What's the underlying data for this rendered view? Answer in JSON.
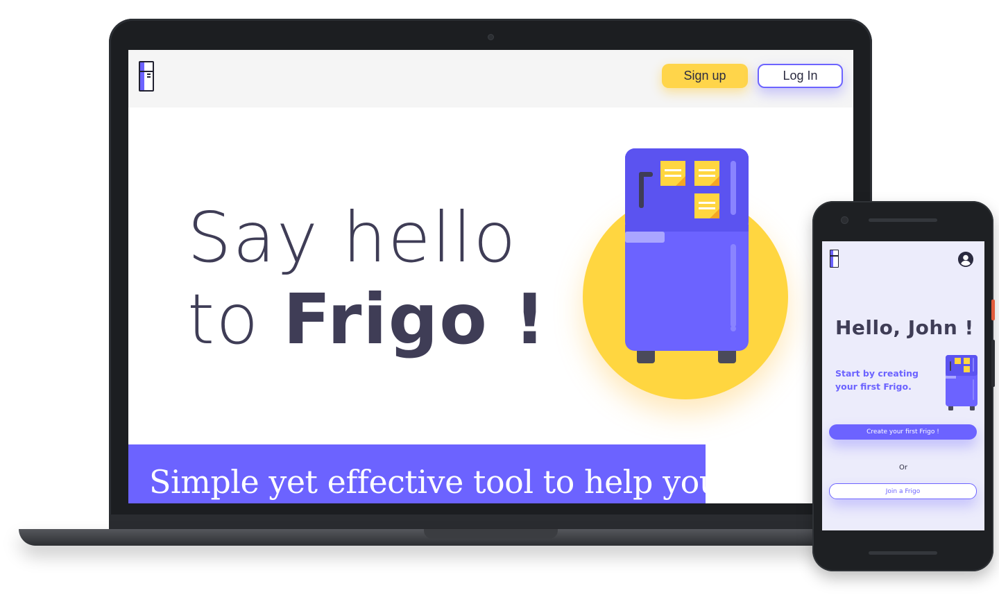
{
  "laptop": {
    "header": {
      "logo_icon": "fridge-logo-icon",
      "signup_label": "Sign up",
      "login_label": "Log In"
    },
    "hero": {
      "title_line1": "Say hello",
      "title_line2_prefix": "to ",
      "title_line2_strong": "Frigo !",
      "illustration_icon": "fridge-with-sticky-notes-icon"
    },
    "tagline": "Simple yet effective tool to help you"
  },
  "phone": {
    "header": {
      "logo_icon": "fridge-logo-icon",
      "account_icon": "user-account-icon"
    },
    "greeting": "Hello, John !",
    "subtitle": "Start by creating your first Frigo.",
    "create_label": "Create your first Frigo !",
    "or_label": "Or",
    "join_label": "Join a Frigo"
  },
  "colors": {
    "accent": "#6c63ff",
    "yellow": "#ffd640",
    "text_dark": "#3f3d56",
    "header_bg": "#f5f5f5"
  }
}
